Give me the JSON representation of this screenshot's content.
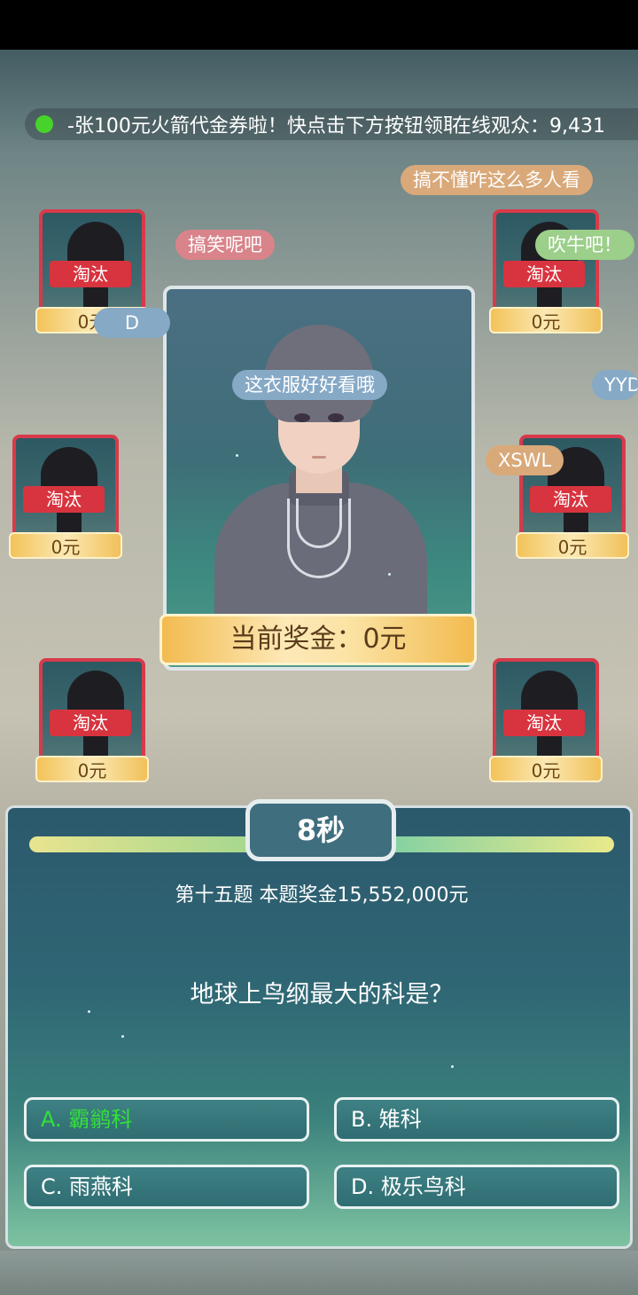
{
  "ticker": {
    "message": "-张100元火箭代金券啦！快点击下方按钮领取",
    "viewers_label": "在线观众：",
    "viewers_count": "9,431"
  },
  "comments": [
    {
      "text": "搞不懂咋这么多人看"
    },
    {
      "text": "搞笑呢吧"
    },
    {
      "text": "吹牛吧！"
    },
    {
      "text": "D"
    },
    {
      "text": "这衣服好好看哦"
    },
    {
      "text": "YYDS"
    },
    {
      "text": "XSWL"
    }
  ],
  "players": [
    {
      "status": "淘汰",
      "money": "0元"
    },
    {
      "status": "淘汰",
      "money": "0元"
    },
    {
      "status": "淘汰",
      "money": "0元"
    },
    {
      "status": "淘汰",
      "money": "0元"
    },
    {
      "status": "淘汰",
      "money": "0元"
    },
    {
      "status": "淘汰",
      "money": "0元"
    }
  ],
  "prize": {
    "label": "当前奖金：0元"
  },
  "quiz": {
    "timer": "8秒",
    "time_remaining_fraction": 1.0,
    "meta": "第十五题 本题奖金15,552,000元",
    "question": "地球上鸟纲最大的科是？",
    "options": [
      {
        "label": "A. 霸鹟科",
        "state": "correct"
      },
      {
        "label": "B. 雉科"
      },
      {
        "label": "C. 雨燕科"
      },
      {
        "label": "D. 极乐鸟科"
      }
    ]
  },
  "colors": {
    "eliminated_tag": "#d8343f",
    "correct_option": "#33e03a",
    "online_dot": "#47d32c"
  }
}
